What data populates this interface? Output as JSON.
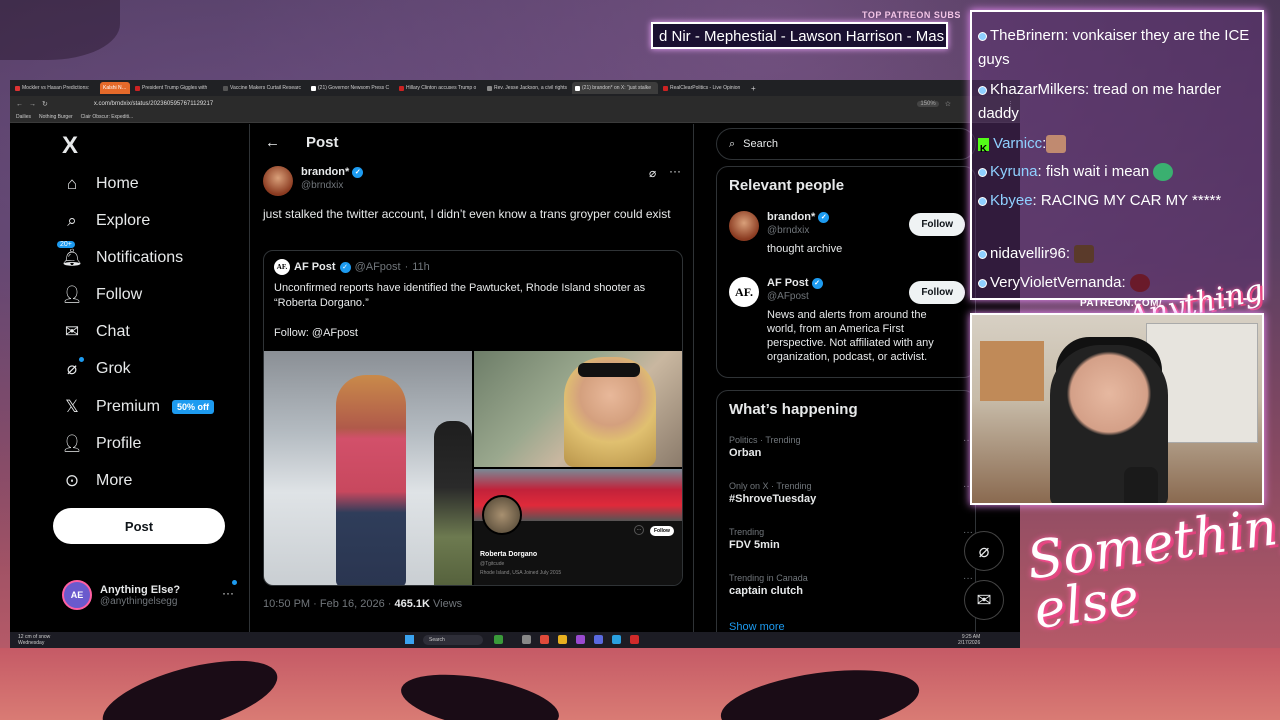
{
  "overlay": {
    "patreon_title": "TOP PATREON SUBS",
    "ticker_text": "d Nir - Mephestial - Lawson Harrison - Mas",
    "patreon_url": "PATREON.COM/",
    "logo_small": "Anything else?",
    "logo_big": "Something else",
    "chat": [
      {
        "user": "TheBrinern",
        "message": ": vonkaiser they are the ICE guys",
        "color": "#ffffff"
      },
      {
        "user": "KhazarMilkers",
        "message": ": tread on me harder daddy",
        "color": "#ffffff"
      },
      {
        "user": "Varnicc",
        "message": ":",
        "color": "#8fd0ff",
        "emote": true
      },
      {
        "user": "Kyruna",
        "message": ": fish wait i mean",
        "color": "#8fd0ff",
        "emote": true
      },
      {
        "user": "Kbyee",
        "message": ": RACING MY CAR MY *****",
        "color": "#8fd0ff"
      },
      {
        "user": "nidavellir96",
        "message": ":",
        "color": "#ffffff",
        "emote": true
      },
      {
        "user": "VeryVioletVernanda",
        "message": ":",
        "color": "#ffffff",
        "emote": true
      }
    ]
  },
  "browser": {
    "tabs": [
      "Mockler vs Hasan Predictions:",
      "Kalshi News",
      "President Trump Giggles with",
      "Vaccine Makers Curtail Researc",
      "(21) Governor Newsom Press C",
      "Hillary Clinton accuses Trump o",
      "Rev. Jesse Jackson, a civil rights",
      "(21) brandon* on X: \"just stalke",
      "RealClearPolitics - Live Opinion"
    ],
    "active_tab_index": 7,
    "url": "x.com/brndxix/status/2023605957671129217",
    "zoom": "150%",
    "bookmarks": [
      "Dailies",
      "Nothing Burger",
      "Clair Obscur: Expediti..."
    ]
  },
  "nav": {
    "logo": "X",
    "items": [
      {
        "label": "Home",
        "icon": "home-icon"
      },
      {
        "label": "Explore",
        "icon": "search-icon"
      },
      {
        "label": "Notifications",
        "icon": "bell-icon",
        "badge": "20+"
      },
      {
        "label": "Follow",
        "icon": "add-person-icon"
      },
      {
        "label": "Chat",
        "icon": "mail-icon"
      },
      {
        "label": "Grok",
        "icon": "grok-icon"
      },
      {
        "label": "Premium",
        "icon": "x-icon",
        "badge": "50% off"
      },
      {
        "label": "Profile",
        "icon": "person-icon"
      },
      {
        "label": "More",
        "icon": "more-circle-icon"
      }
    ],
    "post_button": "Post",
    "account": {
      "name": "Anything Else?",
      "handle": "@anythingelsegg",
      "avatar_text": "AE"
    }
  },
  "post": {
    "header": "Post",
    "author_name": "brandon*",
    "author_handle": "@brndxix",
    "text": "just stalked the twitter account, I didn’t even know a trans groyper could exist",
    "quote": {
      "author_name": "AF Post",
      "author_handle": "@AFpost",
      "time": "11h",
      "avatar_text": "AF.",
      "text": "Unconfirmed reports have identified the Pawtucket, Rhode Island shooter as “Roberta Dorgano.”",
      "follow_line": "Follow: @AFpost",
      "profile_card": {
        "name": "Roberta Dorgano",
        "handle": "@Tgitcude",
        "meta": "Rhode Island, USA  Joined July 2015",
        "follow": "Follow"
      }
    },
    "timestamp": "10:50 PM · Feb 16, 2026 · ",
    "views_count": "465.1K",
    "views_label": " Views"
  },
  "right": {
    "search_placeholder": "Search",
    "relevant_title": "Relevant people",
    "people": [
      {
        "name": "brandon*",
        "handle": "@brndxix",
        "bio": "thought archive",
        "follow": "Follow"
      },
      {
        "name": "AF Post",
        "handle": "@AFpost",
        "bio": "News and alerts from around the world, from an America First perspective. Not affiliated with any organization, podcast, or activist.",
        "follow": "Follow"
      }
    ],
    "happening_title": "What’s happening",
    "trends": [
      {
        "category": "Politics · Trending",
        "title": "Orban"
      },
      {
        "category": "Only on X · Trending",
        "title": "#ShroveTuesday"
      },
      {
        "category": "Trending",
        "title": "FDV 5min"
      },
      {
        "category": "Trending in Canada",
        "title": "captain clutch"
      }
    ],
    "show_more": "Show more"
  },
  "taskbar": {
    "weather": "12 cm of snow",
    "weather_sub": "Wednesday",
    "search": "Search",
    "time": "9:25 AM",
    "date": "2/17/2026"
  }
}
